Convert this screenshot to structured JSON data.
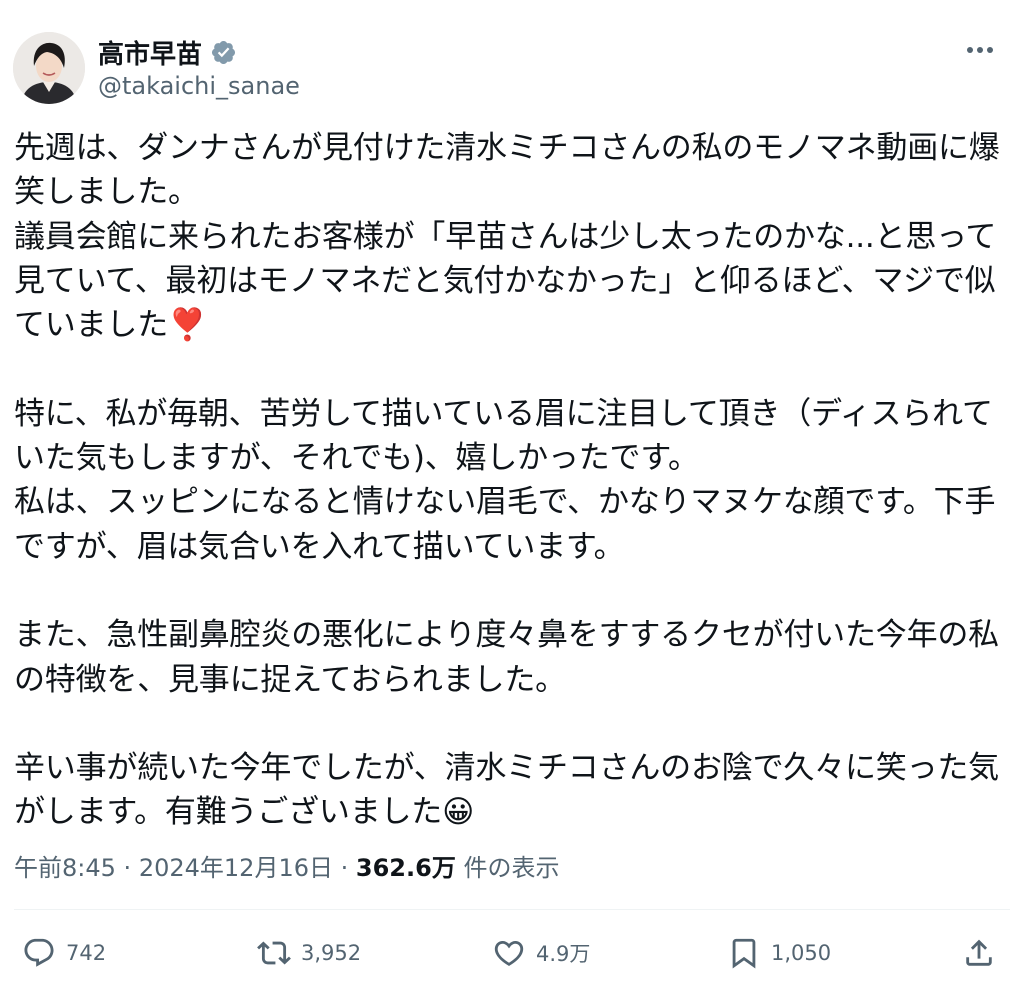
{
  "author": {
    "name": "高市早苗",
    "handle": "@takaichi_sanae",
    "verified": true
  },
  "post": {
    "paragraphs": [
      "先週は、ダンナさんが見付けた清水ミチコさんの私のモノマネ動画に爆笑しました。",
      "議員会館に来られたお客様が「早苗さんは少し太ったのかな...と思って見ていて、最初はモノマネだと気付かなかった」と仰るほど、マジで似ていました",
      "特に、私が毎朝、苦労して描いている眉に注目して頂き（ディスられていた気もしますが、それでも)、嬉しかったです。",
      "私は、スッピンになると情けない眉毛で、かなりマヌケな顔です。下手ですが、眉は気合いを入れて描いています。",
      "また、急性副鼻腔炎の悪化により度々鼻をすするクセが付いた今年の私の特徴を、見事に捉えておられました。",
      "辛い事が続いた今年でしたが、清水ミチコさんのお陰で久々に笑った気がします。有難うございました"
    ],
    "emoji": {
      "exclamation": "❣️",
      "smile": "😀"
    }
  },
  "meta": {
    "time": "午前8:45",
    "date": "2024年12月16日",
    "dot": "·",
    "views": "362.6万",
    "views_label": "件の表示"
  },
  "actions": {
    "replies": "742",
    "reposts": "3,952",
    "likes": "4.9万",
    "bookmarks": "1,050"
  },
  "colors": {
    "text": "#0f1419",
    "secondary": "#536471",
    "verified_badge": "#829aab",
    "divider": "#eff3f4"
  }
}
